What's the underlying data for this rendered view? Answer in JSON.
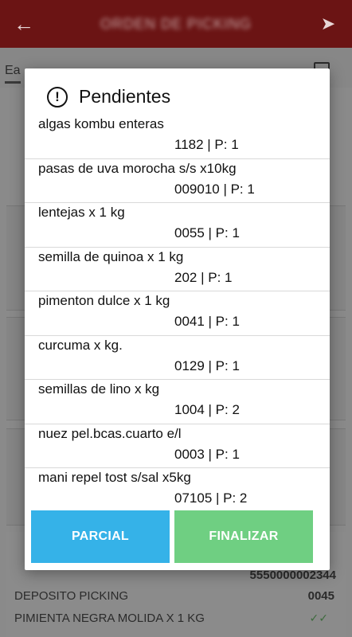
{
  "app_bar": {
    "title": "ORDEN DE PICKING",
    "back_icon": "arrow-left-icon",
    "send_icon": "send-icon"
  },
  "tabs": {
    "first_label": "Ea"
  },
  "dialog": {
    "title": "Pendientes",
    "icon": "alert-circle-icon",
    "items": [
      {
        "name": "algas kombu enteras",
        "meta": "1182 | P: 1"
      },
      {
        "name": "pasas de uva morocha s/s x10kg",
        "meta": "009010 | P: 1"
      },
      {
        "name": "lentejas x 1 kg",
        "meta": "0055 | P: 1"
      },
      {
        "name": "semilla de quinoa x 1 kg",
        "meta": "202 | P: 1"
      },
      {
        "name": "pimenton dulce x 1 kg",
        "meta": "0041 | P: 1"
      },
      {
        "name": "curcuma x kg.",
        "meta": "0129 | P: 1"
      },
      {
        "name": "semillas de lino x kg",
        "meta": "1004 | P: 2"
      },
      {
        "name": "nuez pel.bcas.cuarto e/l",
        "meta": "0003 | P: 1"
      },
      {
        "name": "mani repel tost s/sal x5kg",
        "meta": "07105 | P: 2"
      }
    ],
    "buttons": {
      "parcial": "PARCIAL",
      "finalizar": "FINALIZAR"
    },
    "colors": {
      "parcial": "#35b2e8",
      "finalizar": "#6fcf82"
    }
  },
  "background_card": {
    "barcode": "5550000002344",
    "deposit": "DEPOSITO PICKING",
    "deposit_code": "0045",
    "product": "PIMIENTA NEGRA MOLIDA X 1 KG"
  },
  "colors": {
    "app_bar": "#6b1414"
  }
}
